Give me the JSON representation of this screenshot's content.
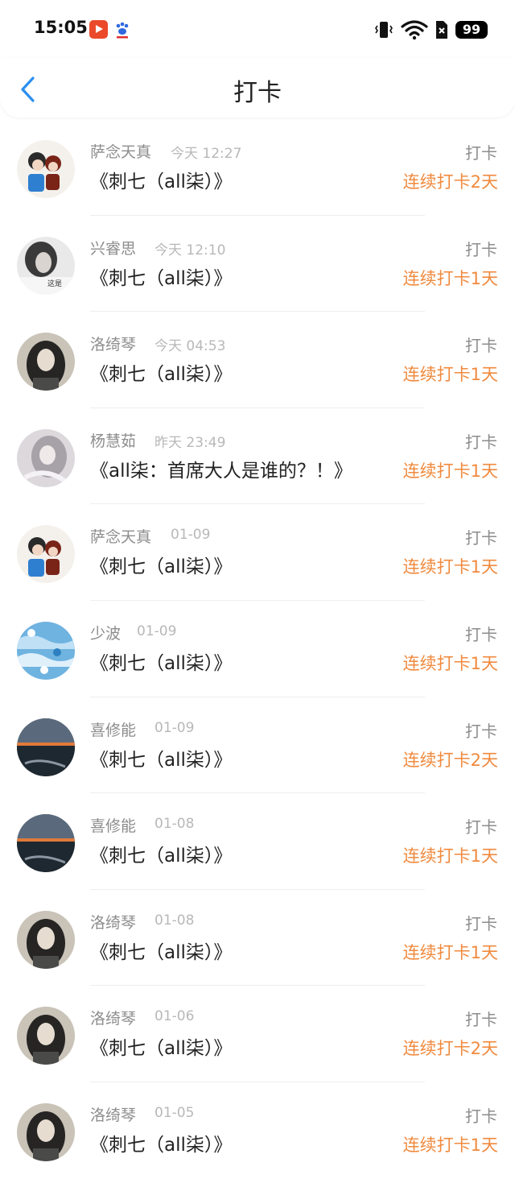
{
  "status_bar": {
    "time": "15:05",
    "battery": "99",
    "icons": [
      "video-app-icon",
      "paw-app-icon",
      "vibrate-icon",
      "wifi-icon",
      "sim-off-icon",
      "battery-icon"
    ]
  },
  "nav": {
    "title": "打卡",
    "back_icon": "chevron-left-icon"
  },
  "colors": {
    "accent": "#f08a3e",
    "back": "#2a8ff0",
    "muted": "#8d8d8d"
  },
  "items": [
    {
      "name": "萨念天真",
      "time": "今天 12:27",
      "book": "《刺七（all柒）》",
      "action": "打卡",
      "streak": "连续打卡2天"
    },
    {
      "name": "兴睿思",
      "time": "今天 12:10",
      "book": "《刺七（all柒）》",
      "action": "打卡",
      "streak": "连续打卡1天"
    },
    {
      "name": "洛绮琴",
      "time": "今天 04:53",
      "book": "《刺七（all柒）》",
      "action": "打卡",
      "streak": "连续打卡1天"
    },
    {
      "name": "杨慧茹",
      "time": "昨天 23:49",
      "book": "《all柒：首席大人是谁的？！》",
      "action": "打卡",
      "streak": "连续打卡1天"
    },
    {
      "name": "萨念天真",
      "time": "01-09",
      "book": "《刺七（all柒）》",
      "action": "打卡",
      "streak": "连续打卡1天"
    },
    {
      "name": "少波",
      "time": "01-09",
      "book": "《刺七（all柒）》",
      "action": "打卡",
      "streak": "连续打卡1天"
    },
    {
      "name": "喜修能",
      "time": "01-09",
      "book": "《刺七（all柒）》",
      "action": "打卡",
      "streak": "连续打卡2天"
    },
    {
      "name": "喜修能",
      "time": "01-08",
      "book": "《刺七（all柒）》",
      "action": "打卡",
      "streak": "连续打卡1天"
    },
    {
      "name": "洛绮琴",
      "time": "01-08",
      "book": "《刺七（all柒）》",
      "action": "打卡",
      "streak": "连续打卡1天"
    },
    {
      "name": "洛绮琴",
      "time": "01-06",
      "book": "《刺七（all柒）》",
      "action": "打卡",
      "streak": "连续打卡2天"
    },
    {
      "name": "洛绮琴",
      "time": "01-05",
      "book": "《刺七（all柒）》",
      "action": "打卡",
      "streak": "连续打卡1天"
    }
  ]
}
